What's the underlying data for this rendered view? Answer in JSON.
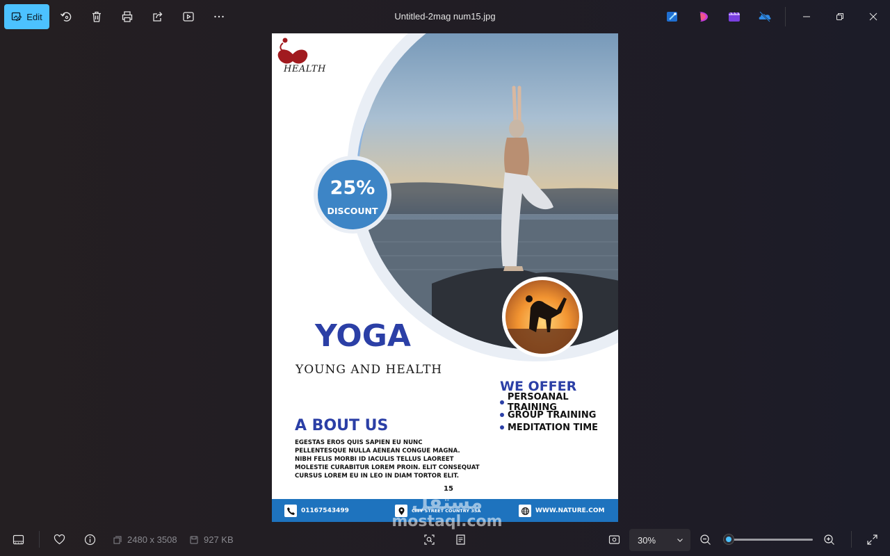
{
  "toolbar": {
    "edit_label": "Edit",
    "file_title": "Untitled-2mag num15.jpg"
  },
  "icons": {
    "rotate": "rotate-icon",
    "delete": "trash-icon",
    "print": "printer-icon",
    "share": "share-icon",
    "slideshow": "slideshow-icon",
    "more": "more-icon"
  },
  "poster": {
    "logo_text": "HEALTH",
    "discount_percent": "25%",
    "discount_label": "DISCOUNT",
    "title": "YOGA",
    "subtitle": "YOUNG AND HEALTH",
    "offer_title": "WE OFFER",
    "offers": [
      "PERSOANAL TRAINING",
      "GROUP TRAINING",
      "MEDITATION TIME"
    ],
    "about_title": "A BOUT US",
    "about_lines": [
      "EGESTAS EROS QUIS SAPIEN EU NUNC",
      "PELLENTESQUE NULLA AENEAN CONGUE MAGNA.",
      "NIBH FELIS MORBI ID IACULIS TELLUS LAOREET",
      "MOLESTIE CURABITUR LOREM PROIN. ELIT CONSEQUAT",
      "CURSUS LOREM EU IN LEO IN DIAM TORTOR ELIT."
    ],
    "page_number": "15",
    "phone": "01167543499",
    "address": "CITY STREET COUNTRY 35A",
    "website": "WWW.NATURE.COM",
    "colors": {
      "accent": "#2b3fa6",
      "bar": "#1e73be",
      "circle": "#3d85c6"
    }
  },
  "watermark": {
    "arabic": "مستقل",
    "latin": "mostaql.com"
  },
  "bottom": {
    "dimensions": "2480 x 3508",
    "file_size": "927 KB",
    "zoom_label": "30%",
    "zoom_fraction": 0.06
  }
}
